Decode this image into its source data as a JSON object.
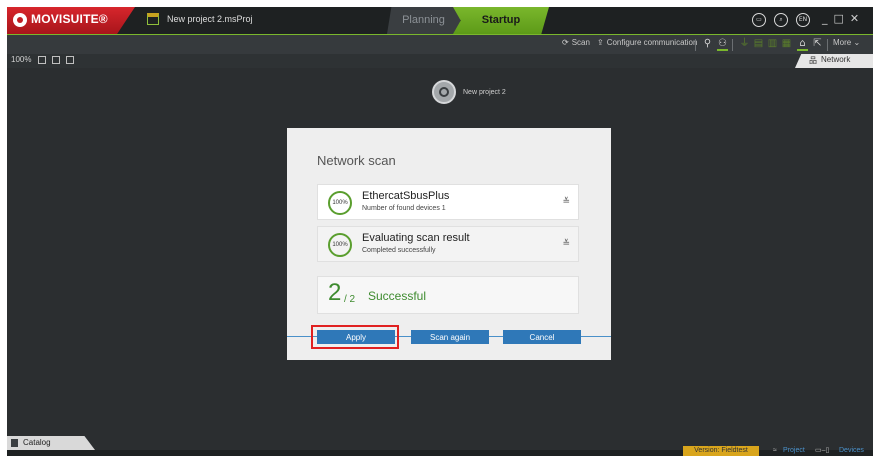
{
  "app": {
    "brand": "MOVISUITE®",
    "project_file": "New project 2.msProj",
    "modes": {
      "planning": "Planning",
      "startup": "Startup"
    },
    "lang": "EN"
  },
  "toolbar": {
    "scan": "Scan",
    "configure": "Configure communication",
    "more": "More"
  },
  "view": {
    "zoom": "100%",
    "network_tab": "Network"
  },
  "canvas": {
    "node_label": "New project 2"
  },
  "dialog": {
    "title": "Network scan",
    "items": [
      {
        "percent": "100%",
        "name": "EthercatSbusPlus",
        "detail": "Number of found devices 1"
      },
      {
        "percent": "100%",
        "name": "Evaluating scan result",
        "detail": "Completed successfully"
      }
    ],
    "result": {
      "count": "2",
      "total": "/ 2",
      "status": "Successful"
    },
    "buttons": {
      "apply": "Apply",
      "scan_again": "Scan again",
      "cancel": "Cancel"
    }
  },
  "bottom": {
    "catalog": "Catalog",
    "version": "Version: Fieldtest",
    "project": "Project",
    "devices": "Devices"
  },
  "colors": {
    "accent_green": "#7ab72c",
    "brand_red": "#c21e24",
    "button_blue": "#2f78b8",
    "highlight_red": "#e02020",
    "version_bg": "#d9a51c"
  }
}
